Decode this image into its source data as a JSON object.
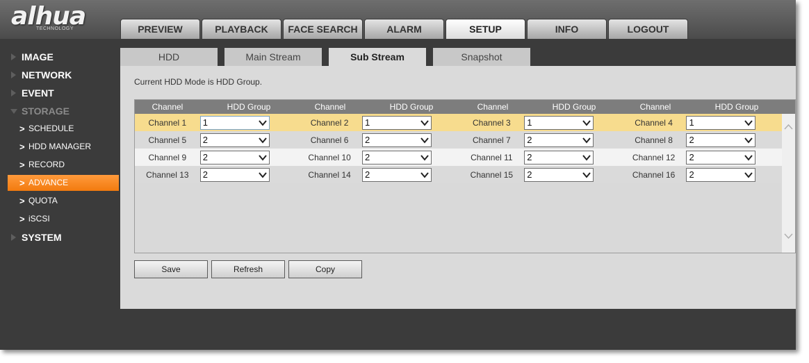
{
  "brand": {
    "logo_text": "alhua",
    "logo_sub": "TECHNOLOGY"
  },
  "main_tabs": [
    {
      "label": "PREVIEW",
      "active": false
    },
    {
      "label": "PLAYBACK",
      "active": false
    },
    {
      "label": "FACE SEARCH",
      "active": false
    },
    {
      "label": "ALARM",
      "active": false
    },
    {
      "label": "SETUP",
      "active": true
    },
    {
      "label": "INFO",
      "active": false
    },
    {
      "label": "LOGOUT",
      "active": false
    }
  ],
  "sidebar": {
    "items": [
      {
        "label": "IMAGE",
        "expanded": false
      },
      {
        "label": "NETWORK",
        "expanded": false
      },
      {
        "label": "EVENT",
        "expanded": false
      },
      {
        "label": "STORAGE",
        "expanded": true,
        "children": [
          {
            "label": "SCHEDULE",
            "active": false
          },
          {
            "label": "HDD MANAGER",
            "active": false
          },
          {
            "label": "RECORD",
            "active": false
          },
          {
            "label": "ADVANCE",
            "active": true
          },
          {
            "label": "QUOTA",
            "active": false
          },
          {
            "label": "iSCSI",
            "active": false
          }
        ]
      },
      {
        "label": "SYSTEM",
        "expanded": false
      }
    ]
  },
  "sub_tabs": [
    {
      "label": "HDD",
      "active": false
    },
    {
      "label": "Main Stream",
      "active": false
    },
    {
      "label": "Sub Stream",
      "active": true
    },
    {
      "label": "Snapshot",
      "active": false
    }
  ],
  "hdd_mode_text": "Current HDD Mode is HDD Group.",
  "grid": {
    "headers": [
      "Channel",
      "HDD Group",
      "Channel",
      "HDD Group",
      "Channel",
      "HDD Group",
      "Channel",
      "HDD Group"
    ],
    "rows": [
      [
        {
          "channel": "Channel 1",
          "group": "1"
        },
        {
          "channel": "Channel 2",
          "group": "1"
        },
        {
          "channel": "Channel 3",
          "group": "1"
        },
        {
          "channel": "Channel 4",
          "group": "1"
        }
      ],
      [
        {
          "channel": "Channel 5",
          "group": "2"
        },
        {
          "channel": "Channel 6",
          "group": "2"
        },
        {
          "channel": "Channel 7",
          "group": "2"
        },
        {
          "channel": "Channel 8",
          "group": "2"
        }
      ],
      [
        {
          "channel": "Channel 9",
          "group": "2"
        },
        {
          "channel": "Channel 10",
          "group": "2"
        },
        {
          "channel": "Channel 11",
          "group": "2"
        },
        {
          "channel": "Channel 12",
          "group": "2"
        }
      ],
      [
        {
          "channel": "Channel 13",
          "group": "2"
        },
        {
          "channel": "Channel 14",
          "group": "2"
        },
        {
          "channel": "Channel 15",
          "group": "2"
        },
        {
          "channel": "Channel 16",
          "group": "2"
        }
      ]
    ]
  },
  "buttons": {
    "save": "Save",
    "refresh": "Refresh",
    "copy": "Copy"
  },
  "colors": {
    "accent": "#f27a0e",
    "selected_row": "#f7dc8e",
    "header": "#7d7d7d"
  }
}
